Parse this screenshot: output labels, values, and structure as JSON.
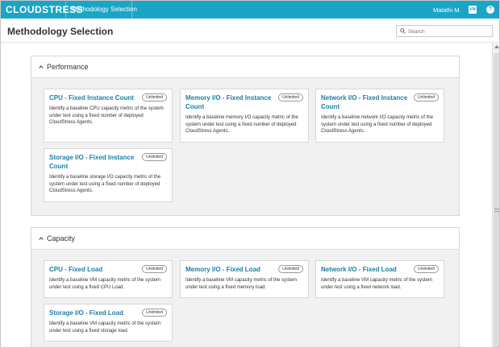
{
  "topbar": {
    "logo": "CLOUDSTRESS",
    "nav_item": "Methodology Selection",
    "user_name": "Malathi M.",
    "user_badge": "VM",
    "help": "?"
  },
  "header": {
    "title": "Methodology Selection",
    "search_placeholder": "Search"
  },
  "sections": [
    {
      "title": "Performance",
      "cards": [
        {
          "title": "CPU - Fixed Instance Count",
          "badge": "Unlimited",
          "desc": "Identify a baseline CPU capacity metric of the system under test using a fixed number of deployed CloudStress Agents."
        },
        {
          "title": "Memory I/O - Fixed Instance Count",
          "badge": "Unlimited",
          "desc": "Identify a baseline memory I/O capacity metric of the system under test using a fixed number of deployed CloudStress Agents."
        },
        {
          "title": "Network I/O - Fixed Instance Count",
          "badge": "Unlimited",
          "desc": "Identify a baseline network I/O capacity metric of the system under test using a fixed number of deployed CloudStress Agents."
        },
        {
          "title": "Storage I/O - Fixed Instance Count",
          "badge": "Unlimited",
          "desc": "Identify a baseline storage I/O capacity metric of the system under test using a fixed number of deployed CloudStress Agents."
        }
      ]
    },
    {
      "title": "Capacity",
      "cards": [
        {
          "title": "CPU - Fixed Load",
          "badge": "Unlimited",
          "desc": "Identify a baseline VM capacity metric of the system under test using a fixed CPU Load."
        },
        {
          "title": "Memory I/O - Fixed Load",
          "badge": "Unlimited",
          "desc": "Identify a baseline VM capacity metric of the system under test using a fixed memory load."
        },
        {
          "title": "Network I/O - Fixed Load",
          "badge": "Unlimited",
          "desc": "Identify a baseline VM capacity metric of the system under test using a fixed network load."
        },
        {
          "title": "Storage I/O - Fixed Load",
          "badge": "Unlimited",
          "desc": "Identify a baseline VM capacity metric of the system under test using a fixed storage load."
        }
      ]
    }
  ],
  "colors": {
    "brand": "#1aa5c7",
    "card_title": "#1a7fa3"
  }
}
